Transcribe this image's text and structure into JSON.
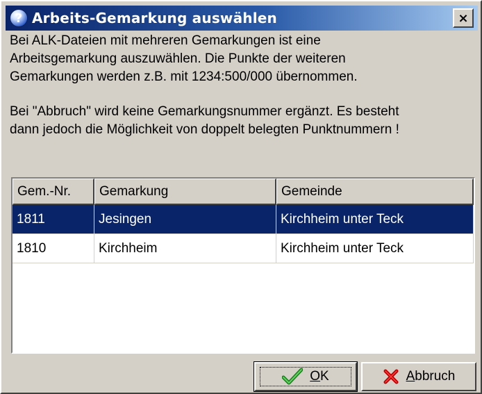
{
  "dialog": {
    "title": "Arbeits-Gemarkung auswählen",
    "close_symbol": "×"
  },
  "message": {
    "paragraph1": "Bei ALK-Dateien mit mehreren Gemarkungen ist  eine\nArbeitsgemarkung auszuwählen. Die Punkte der weiteren\nGemarkungen werden z.B. mit 1234:500/000 übernommen.",
    "paragraph2": "Bei \"Abbruch\" wird keine Gemarkungsnummer ergänzt. Es besteht\ndann jedoch die Möglichkeit von doppelt belegten Punktnummern !"
  },
  "table": {
    "columns": [
      "Gem.-Nr.",
      "Gemarkung",
      "Gemeinde"
    ],
    "rows": [
      {
        "nr": "1811",
        "gemarkung": "Jesingen",
        "gemeinde": "Kirchheim unter Teck",
        "selected": true
      },
      {
        "nr": "1810",
        "gemarkung": "Kirchheim",
        "gemeinde": "Kirchheim unter Teck",
        "selected": false
      }
    ]
  },
  "buttons": {
    "ok": {
      "mnemonic": "O",
      "rest": "K",
      "icon": "checkmark-icon"
    },
    "cancel": {
      "mnemonic": "A",
      "rest": "bbruch",
      "icon": "red-x-icon"
    }
  },
  "colors": {
    "title_bar_start": "#0a246a",
    "title_bar_end": "#a6caf0",
    "selection": "#0a246a",
    "face": "#d4d0c8"
  }
}
